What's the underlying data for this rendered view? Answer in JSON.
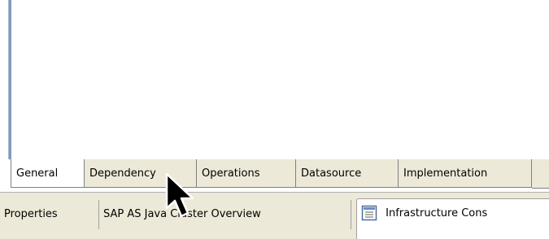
{
  "editor_tabs": [
    {
      "label": "General",
      "active": true
    },
    {
      "label": "Dependency",
      "active": false
    },
    {
      "label": "Operations",
      "active": false
    },
    {
      "label": "Datasource",
      "active": false
    },
    {
      "label": "Implementation",
      "active": false
    }
  ],
  "view_tabs": [
    {
      "label": "Properties",
      "active": false
    },
    {
      "label": "SAP AS Java Cluster Overview",
      "active": false
    },
    {
      "label": "Infrastructure Cons",
      "active": true,
      "icon": "console-view-icon"
    }
  ],
  "colors": {
    "tab_bg": "#ece9d8",
    "active_tab_bg": "#ffffff",
    "border": "#808080",
    "editor_edge": "#7f9db9"
  },
  "cursor": "arrow-pointer"
}
